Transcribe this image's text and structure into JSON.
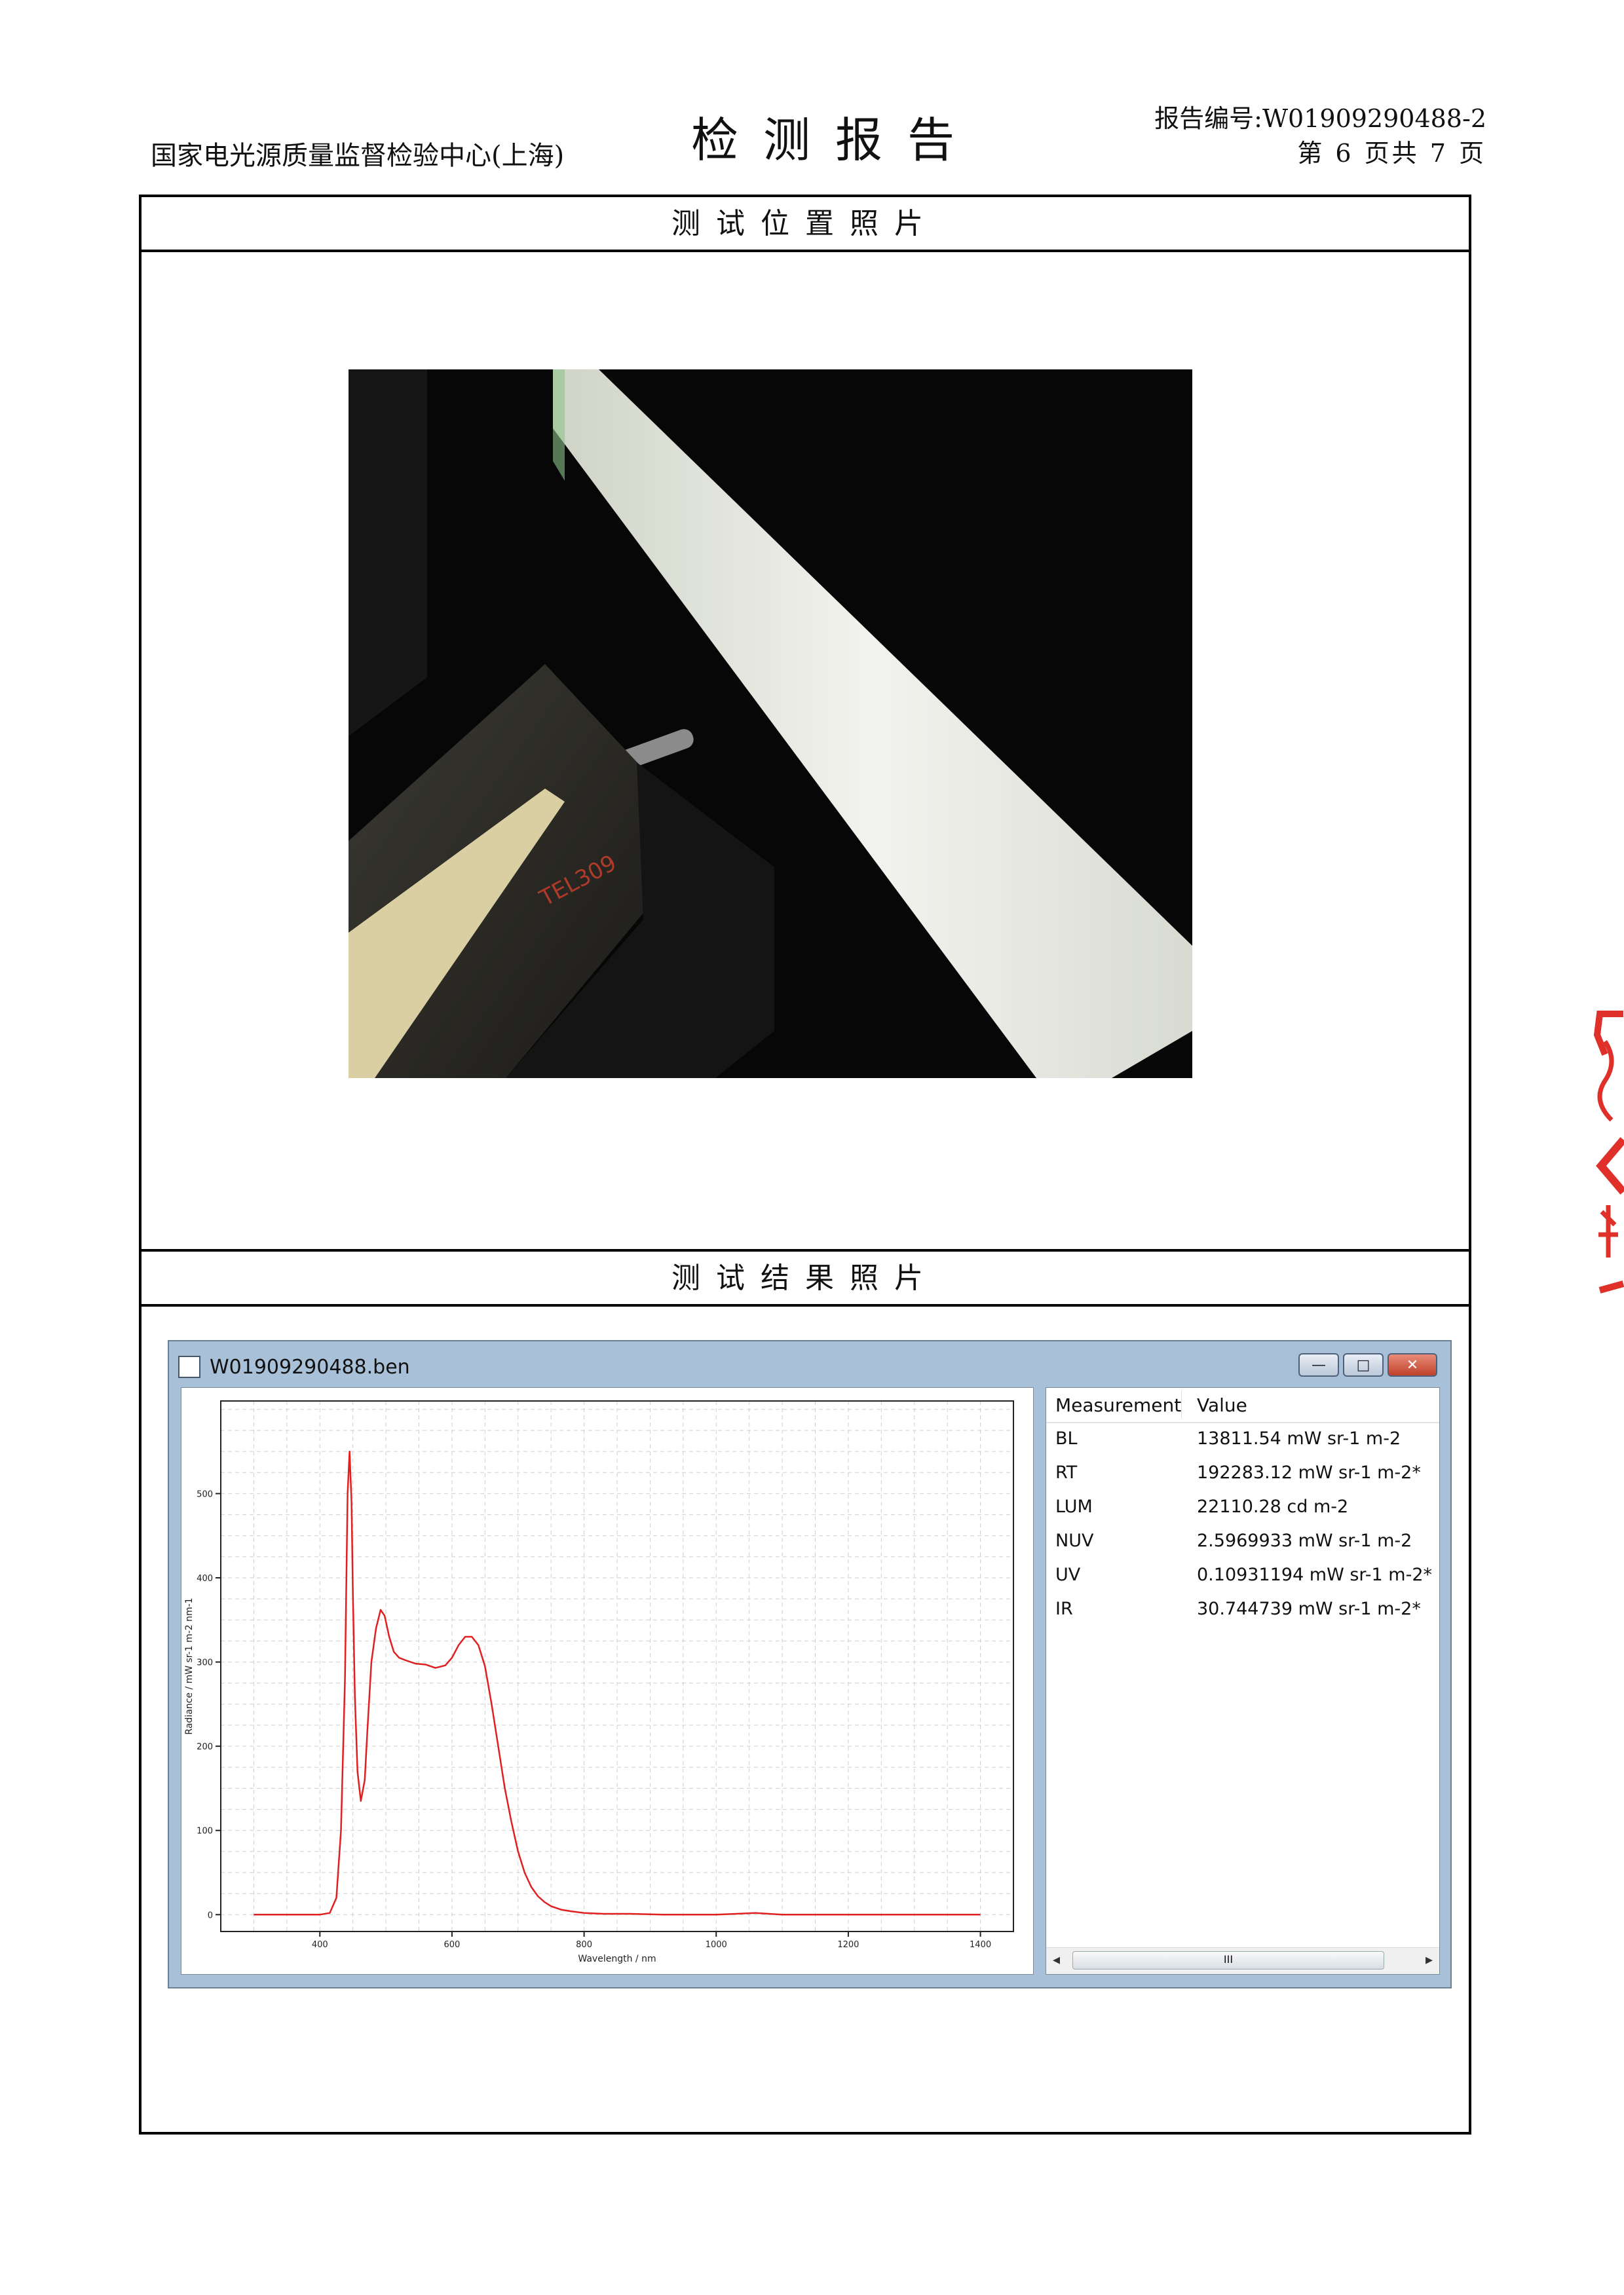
{
  "header": {
    "org": "国家电光源质量监督检验中心(上海)",
    "title": "检测报告",
    "report_no": "报告编号:W01909290488-2",
    "page_info": "第 6 页共 7 页"
  },
  "sections": {
    "photo_title": "测试位置照片",
    "result_title": "测试结果照片"
  },
  "photo": {
    "device_label": "TEL309"
  },
  "window": {
    "title": "W01909290488.ben",
    "buttons": {
      "minimize": "—",
      "maximize": "□",
      "close": "✕"
    }
  },
  "measurements": {
    "header": {
      "col1": "Measurement",
      "col2": "Value"
    },
    "rows": [
      {
        "name": "BL",
        "value": "13811.54 mW sr-1 m-2"
      },
      {
        "name": "RT",
        "value": "192283.12 mW sr-1 m-2*"
      },
      {
        "name": "LUM",
        "value": "22110.28 cd m-2"
      },
      {
        "name": "NUV",
        "value": "2.5969933 mW sr-1 m-2"
      },
      {
        "name": "UV",
        "value": "0.10931194 mW sr-1 m-2*"
      },
      {
        "name": "IR",
        "value": "30.744739 mW sr-1 m-2*"
      }
    ],
    "scroll_thumb": "III"
  },
  "chart_data": {
    "type": "line",
    "xlabel": "Wavelength / nm",
    "ylabel": "Radiance / mW sr-1 m-2 nm-1",
    "xlim": [
      250,
      1450
    ],
    "ylim": [
      -20,
      610
    ],
    "x_ticks": [
      400,
      600,
      800,
      1000,
      1200,
      1400
    ],
    "y_ticks": [
      0,
      100,
      200,
      300,
      400,
      500
    ],
    "grid": true,
    "color": "#e02020",
    "series": [
      {
        "x": [
          300,
          400,
          415,
          425,
          432,
          438,
          442,
          445,
          448,
          450,
          453,
          457,
          462,
          468,
          472,
          478,
          485,
          492,
          498,
          505,
          512,
          520,
          530,
          545,
          560,
          575,
          590,
          600,
          610,
          620,
          630,
          640,
          650,
          660,
          670,
          680,
          690,
          700,
          710,
          720,
          730,
          740,
          750,
          765,
          780,
          800,
          830,
          870,
          920,
          1000,
          1060,
          1100,
          1200,
          1300,
          1400
        ],
        "y": [
          0,
          0,
          2,
          20,
          100,
          280,
          500,
          550,
          490,
          380,
          260,
          170,
          135,
          160,
          220,
          300,
          340,
          362,
          355,
          330,
          312,
          305,
          302,
          298,
          297,
          293,
          296,
          305,
          320,
          330,
          330,
          320,
          295,
          250,
          200,
          150,
          110,
          75,
          50,
          33,
          22,
          15,
          10,
          6,
          4,
          2,
          1,
          1,
          0,
          0,
          2,
          0,
          0,
          0,
          0
        ]
      }
    ]
  }
}
